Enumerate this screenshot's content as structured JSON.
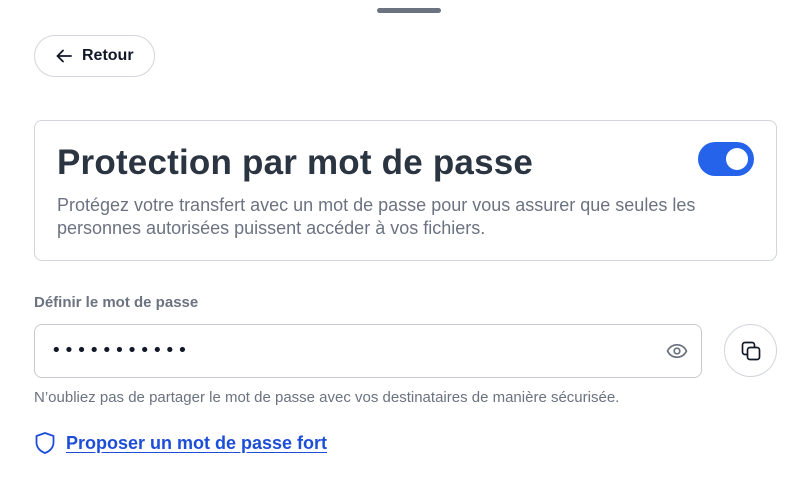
{
  "header": {
    "back_label": "Retour"
  },
  "protection": {
    "title": "Protection par mot de passe",
    "description": "Protégez votre transfert avec un mot de passe pour vous assurer que seules les personnes autorisées puissent accéder à vos fichiers.",
    "enabled": true
  },
  "password": {
    "label": "Définir le mot de passe",
    "masked_value": "•••••••••••",
    "helper": "N’oubliez pas de partager le mot de passe avec vos destinataires de manière sécurisée."
  },
  "suggest": {
    "label": "Proposer un mot de passe fort"
  },
  "icons": {
    "back": "arrow-left-icon",
    "show_password": "eye-icon",
    "copy": "copy-icon",
    "suggest": "shield-icon"
  },
  "colors": {
    "accent": "#2563eb",
    "link": "#1d4ed8",
    "muted_text": "#6b7280",
    "title_text": "#2b3441",
    "border": "#d1d5db"
  }
}
